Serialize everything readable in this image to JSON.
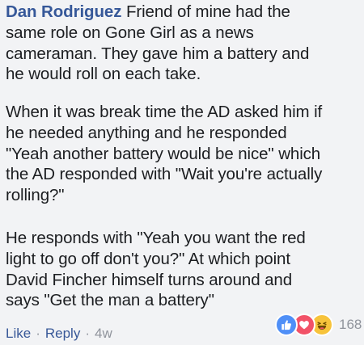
{
  "comment": {
    "author": "Dan Rodriguez",
    "paragraphs": [
      {
        "line1": " Friend of mine had the",
        "lines": [
          "same role on Gone Girl as a news",
          "cameraman. They gave him a battery and",
          "he would roll on each take."
        ]
      },
      {
        "lines": [
          "When it was break time the AD asked him if",
          "he needed anything and he responded",
          "\"Yeah another battery would be nice\" which",
          "the AD responded with \"Wait you're actually",
          "rolling?\""
        ]
      },
      {
        "lines": [
          "He responds with \"Yeah you want the red",
          "light to go off don't you?\" At which point",
          "David Fincher himself turns around and",
          "says \"Get the man a battery\""
        ]
      }
    ]
  },
  "actions": {
    "like_label": "Like",
    "reply_label": "Reply",
    "separator": "·",
    "timestamp": "4w"
  },
  "reactions": {
    "icons": [
      "like-icon",
      "love-icon",
      "haha-icon"
    ],
    "count": "168",
    "colors": {
      "like": "#4f8ff7",
      "love": "#f25268",
      "haha": "#f7c33b"
    }
  },
  "colors": {
    "author": "#365899",
    "link": "#385898",
    "muted": "#90949c",
    "text": "#1c1e21",
    "background": "#f2f3f5"
  }
}
